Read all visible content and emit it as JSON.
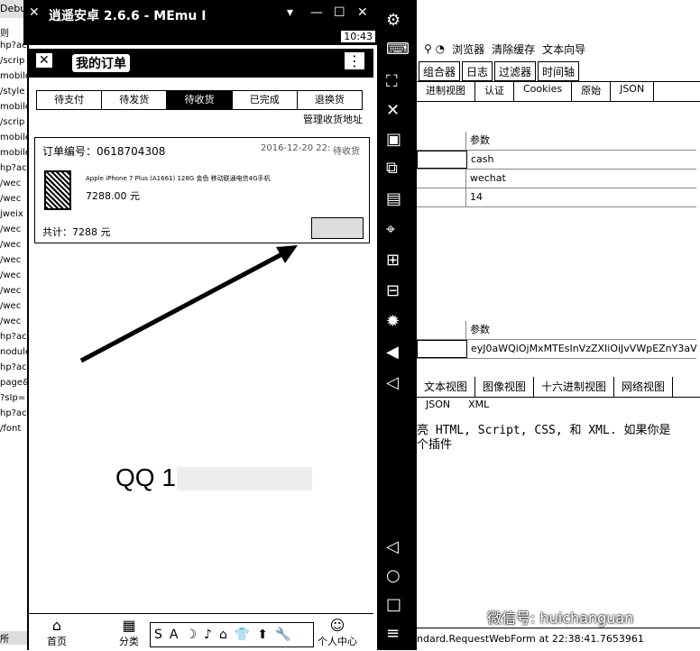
{
  "left_bg": {
    "title": "Debu",
    "lines": [
      "则",
      "hp?ac",
      "/scrip",
      "mobile",
      "/style",
      "mobile",
      "/scrip",
      "mobile",
      "mobile",
      "hp?ac",
      "/wec",
      "/wec",
      "jweix",
      "/wec",
      "/wec",
      "/wec",
      "/wec",
      "/wec",
      "/wec",
      "/wec",
      "hp?ac",
      "nodule",
      "hp?ac",
      "page&",
      "?sIp=",
      "hp?ac",
      "/font"
    ],
    "footer": "所"
  },
  "memu": {
    "title": "逍遥安卓 2.6.6 - MEmu I",
    "time": "10:43",
    "controls": [
      "▾",
      "—",
      "☐",
      "✕"
    ]
  },
  "app": {
    "title": "我的订单",
    "menu_icon": "⋮",
    "tabs": [
      "待支付",
      "待发货",
      "待收货",
      "已完成",
      "退换货"
    ],
    "active_tab": 2,
    "manage_address": "管理收货地址",
    "order": {
      "number": "订单编号：0618704308",
      "date": "2016-12-20 22:",
      "status": "待收货",
      "product": "Apple iPhone 7 Plus (A1661) 128G 金色 移动联通电信4G手机",
      "price": "7288.00 元",
      "total": "共计：7288 元"
    },
    "qq": "QQ 1",
    "nav": [
      {
        "label": "首页"
      },
      {
        "label": "分类"
      },
      {
        "label": "个人中心"
      }
    ]
  },
  "ime": [
    "S",
    "A",
    "☽",
    "♪",
    "⌂",
    "👕",
    "⬆",
    "🔧"
  ],
  "fiddler": {
    "toolbar": [
      "浏览器",
      "清除缓存",
      "文本向导"
    ],
    "tabs1": [
      "组合器",
      "日志",
      "过滤器",
      "时间轴"
    ],
    "tabs2": [
      "进制视图",
      "认证",
      "Cookies",
      "原始",
      "JSON"
    ],
    "grid1": {
      "header": "参数",
      "rows": [
        "cash",
        "wechat",
        "14"
      ]
    },
    "grid2": {
      "header": "参数",
      "rows": [
        "eyJ0aWQiOjMxMTEsInVzZXIiOiJvVWpEZnY3aVJ6NH"
      ]
    },
    "tabs3": [
      "文本视图",
      "图像视图",
      "十六进制视图",
      "网络视图"
    ],
    "tabs4": [
      "JSON",
      "XML"
    ],
    "text1": "亮 HTML, Script, CSS, 和 XML. 如果你是",
    "text2": "个插件",
    "status": "ndard.RequestWebForm at 22:38:41.7653961"
  },
  "watermark": "微信号: huichanguan"
}
